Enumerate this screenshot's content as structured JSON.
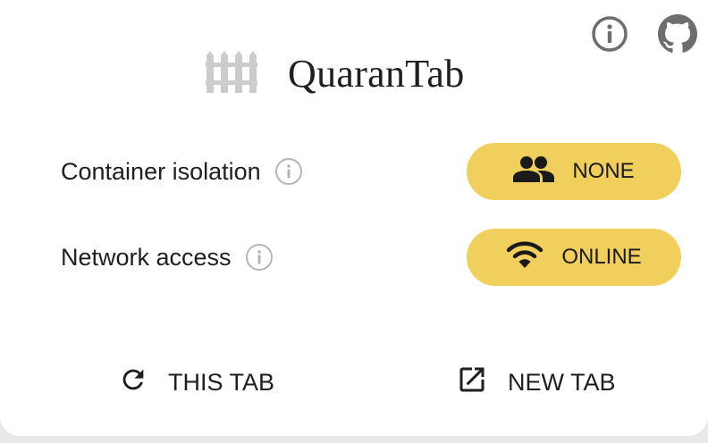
{
  "header": {
    "title": "QuaranTab",
    "logo_icon": "fence-icon",
    "info_icon": "info-icon",
    "github_icon": "github-icon"
  },
  "settings": [
    {
      "label": "Container isolation",
      "info_icon": "info-icon",
      "value_icon": "people-icon",
      "value": "NONE"
    },
    {
      "label": "Network access",
      "info_icon": "info-icon",
      "value_icon": "wifi-icon",
      "value": "ONLINE"
    }
  ],
  "actions": {
    "this_tab": {
      "label": "THIS TAB",
      "icon": "refresh-icon"
    },
    "new_tab": {
      "label": "NEW TAB",
      "icon": "open-in-new-icon"
    }
  },
  "colors": {
    "accent": "#f0cf5c",
    "text": "#1f1f1f",
    "icon_grey": "#6e6e6e",
    "logo_grey": "#cccccc",
    "info_grey": "#b5b5b5"
  }
}
